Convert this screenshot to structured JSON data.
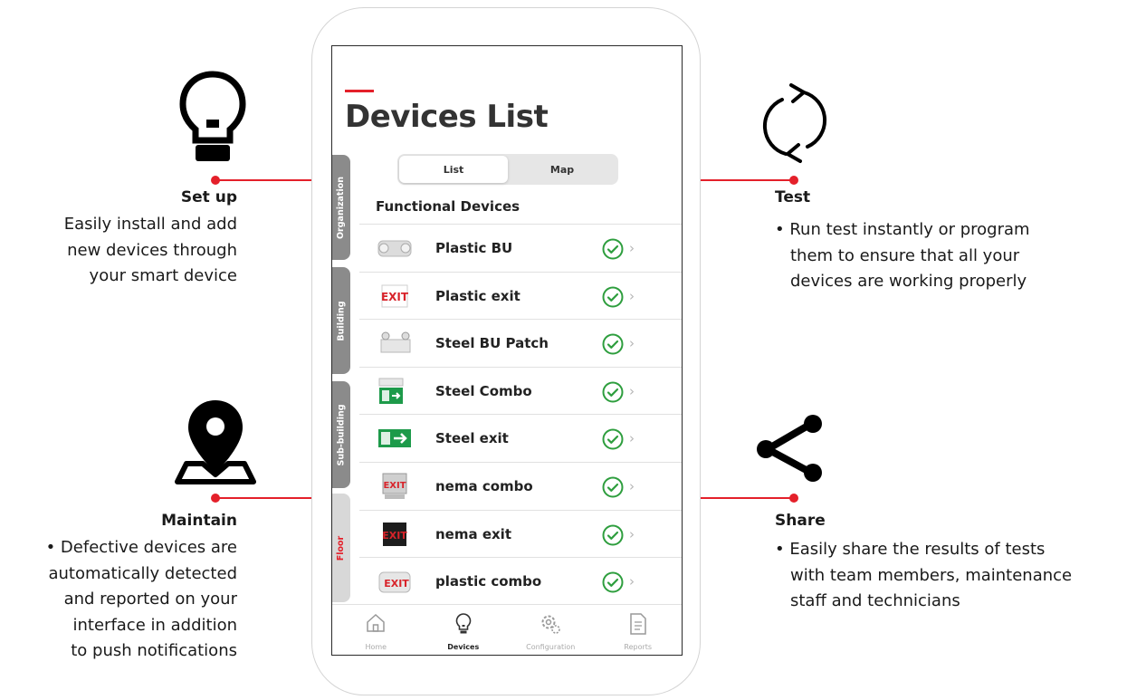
{
  "screen": {
    "title": "Devices List",
    "segments": [
      {
        "label": "List",
        "active": true
      },
      {
        "label": "Map",
        "active": false
      }
    ],
    "section_title": "Functional Devices",
    "side_tabs": [
      {
        "label": "Organization",
        "active": false
      },
      {
        "label": "Building",
        "active": false
      },
      {
        "label": "Sub-building",
        "active": false
      },
      {
        "label": "Floor",
        "active": true
      }
    ],
    "devices": [
      {
        "name": "Plastic BU",
        "thumb": "emergency-light-icon",
        "status": "ok"
      },
      {
        "name": "Plastic exit",
        "thumb": "exit-sign-red-icon",
        "status": "ok"
      },
      {
        "name": "Steel BU Patch",
        "thumb": "emergency-light-steel-icon",
        "status": "ok"
      },
      {
        "name": "Steel Combo",
        "thumb": "exit-combo-green-icon",
        "status": "ok"
      },
      {
        "name": "Steel exit",
        "thumb": "exit-sign-green-icon",
        "status": "ok"
      },
      {
        "name": "nema combo",
        "thumb": "exit-combo-red-icon",
        "status": "ok"
      },
      {
        "name": "nema exit",
        "thumb": "exit-sign-black-icon",
        "status": "ok"
      },
      {
        "name": "plastic combo",
        "thumb": "exit-combo-plastic-icon",
        "status": "ok"
      }
    ],
    "tabbar": [
      {
        "label": "Home",
        "icon": "home-icon",
        "active": false
      },
      {
        "label": "Devices",
        "icon": "lightbulb-icon",
        "active": true
      },
      {
        "label": "Configuration",
        "icon": "gear-icon",
        "active": false
      },
      {
        "label": "Reports",
        "icon": "document-icon",
        "active": false
      }
    ]
  },
  "callouts": {
    "setup": {
      "title": "Set up",
      "lines": [
        "Easily install and add",
        "new devices through",
        "your smart device"
      ],
      "icon": "lightbulb-icon"
    },
    "maintain": {
      "title": "Maintain",
      "lines": [
        "• Defective devices are",
        "automatically detected",
        "and reported on your",
        "interface in addition",
        "to push notifications"
      ],
      "icon": "location-pin-icon"
    },
    "test": {
      "title": "Test",
      "lines": [
        "• Run test instantly or program",
        "them to ensure that all your",
        "devices are working properly"
      ],
      "icon": "refresh-cycle-icon"
    },
    "share": {
      "title": "Share",
      "lines": [
        "• Easily share the results of tests",
        "with team members, maintenance",
        "staff and technicians"
      ],
      "icon": "share-icon"
    }
  },
  "colors": {
    "accent": "#e4202a",
    "check": "#2e9e3e",
    "tab_inactive": "#8b8b8b"
  }
}
